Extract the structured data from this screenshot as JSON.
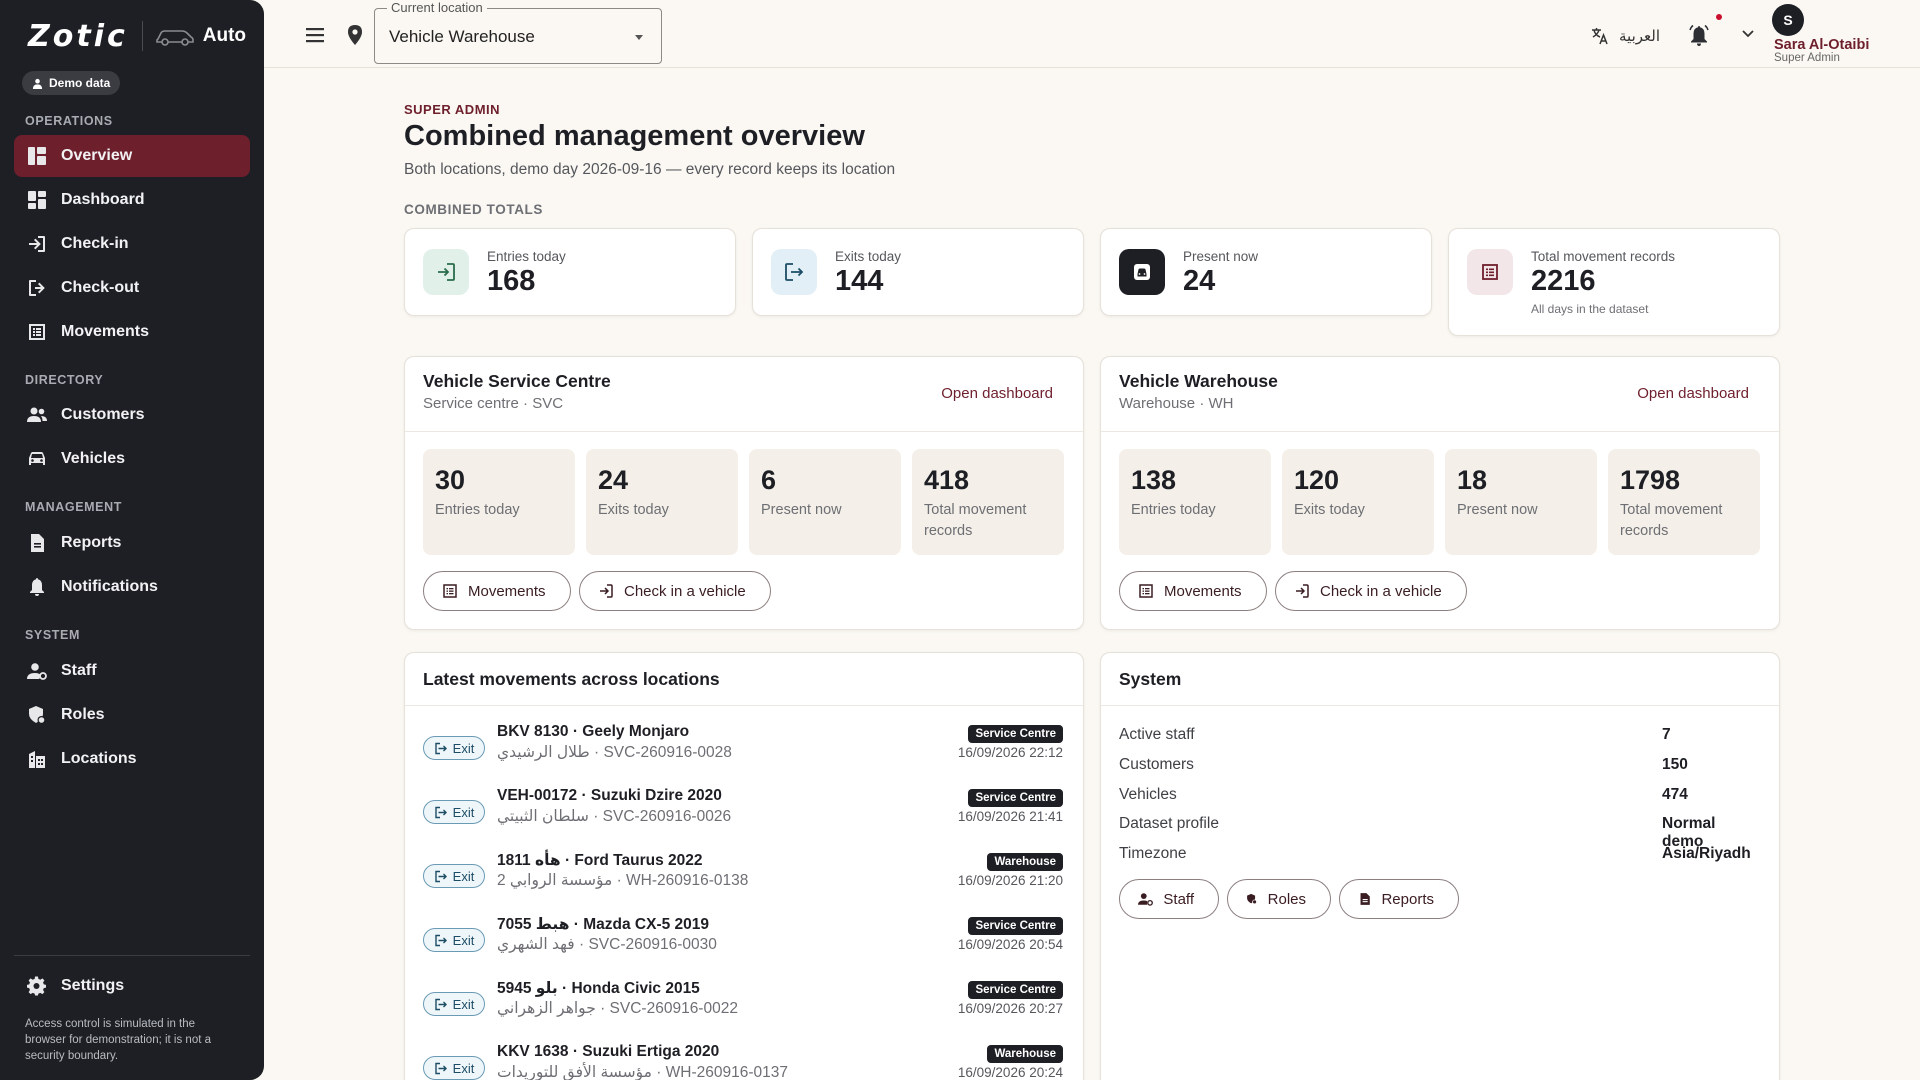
{
  "app": {
    "brand": "Zotic",
    "product": "Auto",
    "demo_chip": "Demo data"
  },
  "sidebar": {
    "sections": {
      "operations": "OPERATIONS",
      "directory": "DIRECTORY",
      "management": "MANAGEMENT",
      "system": "SYSTEM"
    },
    "items": [
      {
        "label": "Overview",
        "icon": "overview-icon",
        "active": true
      },
      {
        "label": "Dashboard",
        "icon": "dashboard-icon"
      },
      {
        "label": "Check-in",
        "icon": "check-in-icon"
      },
      {
        "label": "Check-out",
        "icon": "check-out-icon"
      },
      {
        "label": "Movements",
        "icon": "movements-icon"
      },
      {
        "label": "Customers",
        "icon": "customers-icon"
      },
      {
        "label": "Vehicles",
        "icon": "car-icon"
      },
      {
        "label": "Reports",
        "icon": "reports-icon"
      },
      {
        "label": "Notifications",
        "icon": "bell-icon"
      },
      {
        "label": "Staff",
        "icon": "staff-icon"
      },
      {
        "label": "Roles",
        "icon": "roles-icon"
      },
      {
        "label": "Locations",
        "icon": "building-icon"
      }
    ],
    "settings": "Settings",
    "note": "Access control is simulated in the browser for demonstration; it is not a security boundary."
  },
  "topbar": {
    "location_legend": "Current location",
    "location_value": "Vehicle Warehouse",
    "language": "العربية",
    "user_initial": "S",
    "user_name": "Sara Al-Otaibi",
    "user_role": "Super Admin"
  },
  "page": {
    "eyebrow": "SUPER ADMIN",
    "title": "Combined management overview",
    "subtitle": "Both locations, demo day 2026-09-16 — every record keeps its location",
    "totals_label": "COMBINED TOTALS"
  },
  "kpis": [
    {
      "label": "Entries today",
      "value": "168",
      "icon": "entry-icon"
    },
    {
      "label": "Exits today",
      "value": "144",
      "icon": "exit-icon"
    },
    {
      "label": "Present now",
      "value": "24",
      "icon": "car-icon"
    },
    {
      "label": "Total movement records",
      "value": "2216",
      "note": "All days in the dataset",
      "icon": "list-icon"
    }
  ],
  "locations": [
    {
      "name": "Vehicle Service Centre",
      "sub": "Service centre · SVC",
      "link": "Open dashboard",
      "stats": [
        {
          "value": "30",
          "label": "Entries today"
        },
        {
          "value": "24",
          "label": "Exits today"
        },
        {
          "value": "6",
          "label": "Present now"
        },
        {
          "value": "418",
          "label": "Total movement records"
        }
      ],
      "btn_movements": "Movements",
      "btn_checkin": "Check in a vehicle"
    },
    {
      "name": "Vehicle Warehouse",
      "sub": "Warehouse · WH",
      "link": "Open dashboard",
      "stats": [
        {
          "value": "138",
          "label": "Entries today"
        },
        {
          "value": "120",
          "label": "Exits today"
        },
        {
          "value": "18",
          "label": "Present now"
        },
        {
          "value": "1798",
          "label": "Total movement records"
        }
      ],
      "btn_movements": "Movements",
      "btn_checkin": "Check in a vehicle"
    }
  ],
  "latest": {
    "title": "Latest movements across locations",
    "rows": [
      {
        "type": "Exit",
        "title": "BKV 8130 · Geely Monjaro",
        "sub": "طلال الرشيدي · SVC-260916-0028",
        "badge": "Service Centre",
        "time": "16/09/2026 22:12"
      },
      {
        "type": "Exit",
        "title": "VEH-00172 · Suzuki Dzire 2020",
        "sub": "سلطان الثبيتي · SVC-260916-0026",
        "badge": "Service Centre",
        "time": "16/09/2026 21:41"
      },
      {
        "type": "Exit",
        "title": "1811 هأه · Ford Taurus 2022",
        "sub": "مؤسسة الروابي 2 · WH-260916-0138",
        "badge": "Warehouse",
        "time": "16/09/2026 21:20"
      },
      {
        "type": "Exit",
        "title": "7055 هبط · Mazda CX-5 2019",
        "sub": "فهد الشهري · SVC-260916-0030",
        "badge": "Service Centre",
        "time": "16/09/2026 20:54"
      },
      {
        "type": "Exit",
        "title": "5945 بلو · Honda Civic 2015",
        "sub": "جواهر الزهراني · SVC-260916-0022",
        "badge": "Service Centre",
        "time": "16/09/2026 20:27"
      },
      {
        "type": "Exit",
        "title": "KKV 1638 · Suzuki Ertiga 2020",
        "sub": "مؤسسة الأفق للتوريدات · WH-260916-0137",
        "badge": "Warehouse",
        "time": "16/09/2026 20:24"
      }
    ]
  },
  "system": {
    "title": "System",
    "rows": [
      {
        "label": "Active staff",
        "value": "7"
      },
      {
        "label": "Customers",
        "value": "150"
      },
      {
        "label": "Vehicles",
        "value": "474"
      },
      {
        "label": "Dataset profile",
        "value": "Normal demo"
      },
      {
        "label": "Timezone",
        "value": "Asia/Riyadh"
      }
    ],
    "buttons": [
      "Staff",
      "Roles",
      "Reports"
    ]
  },
  "colors": {
    "sidebar_bg": "#1d1f24",
    "active_nav": "#6e1f2c",
    "accent": "#6e1f2c",
    "page_bg": "#fbf8f3",
    "alert_dot": "#c8102e"
  }
}
